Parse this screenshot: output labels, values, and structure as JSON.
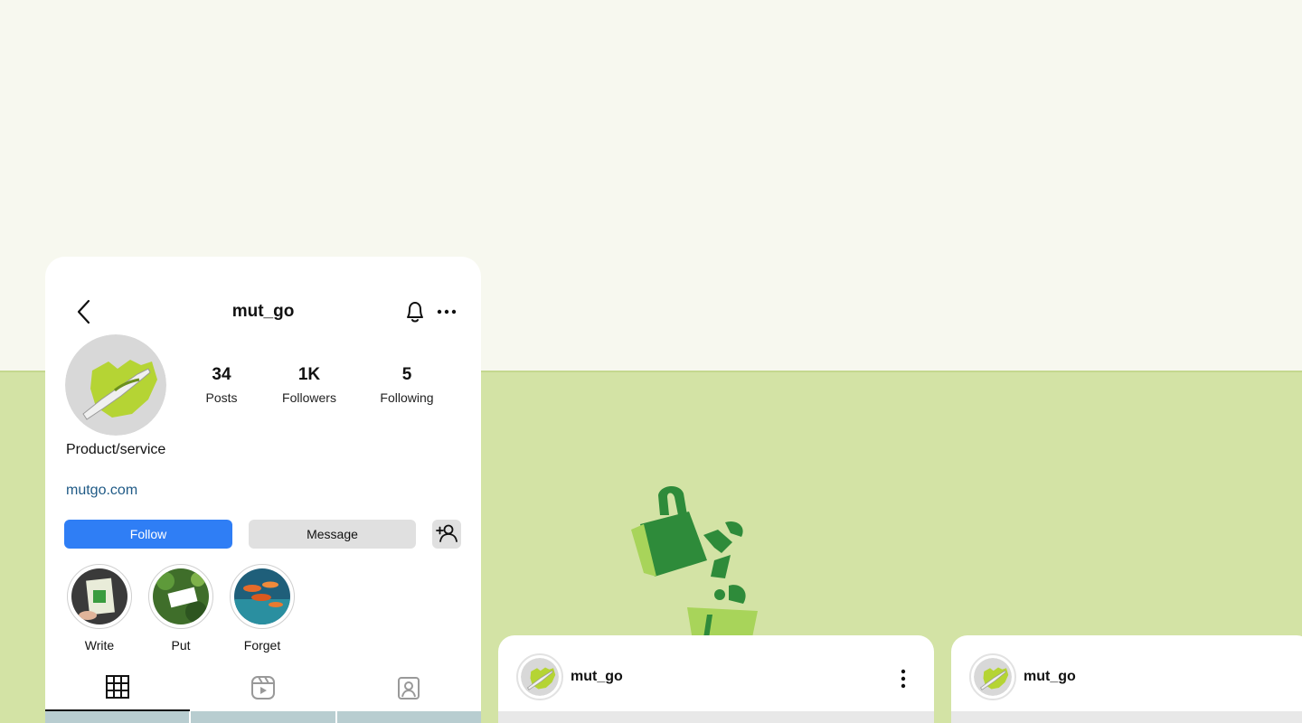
{
  "profile": {
    "username": "mut_go",
    "stats": [
      {
        "value": "34",
        "label": "Posts"
      },
      {
        "value": "1K",
        "label": "Followers"
      },
      {
        "value": "5",
        "label": "Following"
      }
    ],
    "category": "Product/service",
    "website": "mutgo.com",
    "follow_label": "Follow",
    "message_label": "Message",
    "highlights": [
      {
        "label": "Write"
      },
      {
        "label": "Put"
      },
      {
        "label": "Forget"
      }
    ]
  },
  "posts": [
    {
      "username": "mut_go"
    },
    {
      "username": "mut_go"
    }
  ],
  "colors": {
    "page_top": "#f7f8ef",
    "page_bottom": "#d3e3a5",
    "follow_button": "#2f7ef5",
    "link": "#1f5a86",
    "illustration_dark": "#2e8b3a",
    "illustration_light": "#a8d45a"
  },
  "icons": [
    "back-arrow-icon",
    "bell-icon",
    "more-horizontal-icon",
    "add-user-icon",
    "grid-icon",
    "reels-icon",
    "tagged-icon",
    "more-vertical-icon"
  ]
}
